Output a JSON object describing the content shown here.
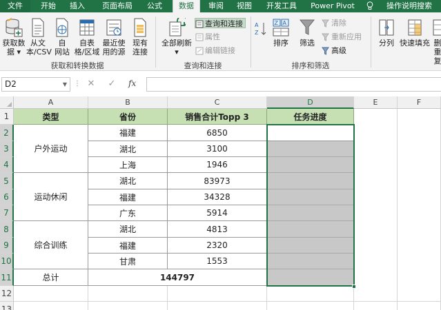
{
  "tabs": [
    {
      "label": "文件",
      "active": false
    },
    {
      "label": "开始",
      "active": false
    },
    {
      "label": "插入",
      "active": false
    },
    {
      "label": "页面布局",
      "active": false
    },
    {
      "label": "公式",
      "active": false
    },
    {
      "label": "数据",
      "active": true
    },
    {
      "label": "审阅",
      "active": false
    },
    {
      "label": "视图",
      "active": false
    },
    {
      "label": "开发工具",
      "active": false
    },
    {
      "label": "Power Pivot",
      "active": false
    }
  ],
  "tell_me": "操作说明搜索",
  "ribbon": {
    "get_transform": {
      "label": "获取和转换数据",
      "buttons": [
        {
          "line1": "获取数",
          "line2": "据 ▾"
        },
        {
          "line1": "从文",
          "line2": "本/CSV"
        },
        {
          "line1": "自",
          "line2": "网站"
        },
        {
          "line1": "自表",
          "line2": "格/区域"
        },
        {
          "line1": "最近使",
          "line2": "用的源"
        },
        {
          "line1": "现有",
          "line2": "连接"
        }
      ]
    },
    "queries": {
      "label": "查询和连接",
      "refresh_all": {
        "line1": "全部刷新",
        "line2": "▾"
      },
      "queries_connections": "查询和连接",
      "properties": "属性",
      "edit_links": "编辑链接"
    },
    "sort_filter": {
      "label": "排序和筛选",
      "sort": "排序",
      "filter": "筛选",
      "clear": "清除",
      "reapply": "重新应用",
      "advanced": "高级"
    },
    "data_tools": {
      "split": "分列",
      "flash_fill": "快速填充",
      "remove_dup_line1": "删",
      "remove_dup_line2": "重复"
    }
  },
  "formula_bar": {
    "name_box": "D2",
    "fx": "fx",
    "cancel": "✕",
    "enter": "✓",
    "value": ""
  },
  "grid": {
    "columns": [
      "A",
      "B",
      "C",
      "D",
      "E",
      "F"
    ],
    "rows": [
      "1",
      "2",
      "3",
      "4",
      "5",
      "6",
      "7",
      "8",
      "9",
      "10",
      "11",
      "12",
      "13"
    ],
    "headers": {
      "type": "类型",
      "province": "省份",
      "sales": "销售合计Topp 3",
      "progress": "任务进度"
    },
    "groups": [
      "户外运动",
      "运动休闲",
      "综合训练"
    ],
    "data": [
      {
        "province": "福建",
        "sales": "6850"
      },
      {
        "province": "湖北",
        "sales": "3100"
      },
      {
        "province": "上海",
        "sales": "1946"
      },
      {
        "province": "湖北",
        "sales": "83973"
      },
      {
        "province": "福建",
        "sales": "34328"
      },
      {
        "province": "广东",
        "sales": "5914"
      },
      {
        "province": "湖北",
        "sales": "4813"
      },
      {
        "province": "福建",
        "sales": "2320"
      },
      {
        "province": "甘肃",
        "sales": "1553"
      }
    ],
    "total_label": "总计",
    "total_value": "144797"
  }
}
